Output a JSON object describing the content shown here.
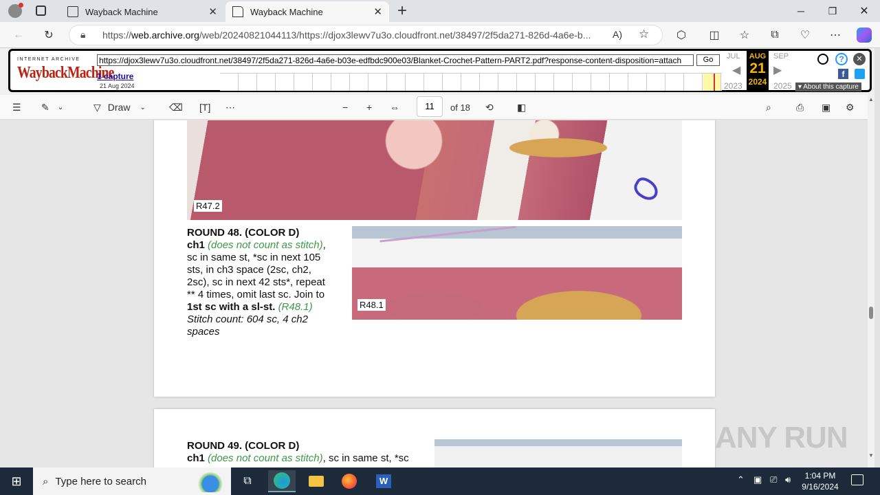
{
  "browser": {
    "tabs": [
      {
        "title": "Wayback Machine",
        "active": false
      },
      {
        "title": "Wayback Machine",
        "active": true
      }
    ],
    "new_tab": "+",
    "url_prefix": "https://",
    "url_domain": "web.archive.org",
    "url_rest": "/web/20240821044113/https://djox3lewv7u3o.cloudfront.net/38497/2f5da271-826d-4a6e-b..."
  },
  "wayback": {
    "logo_top": "INTERNET ARCHIVE",
    "logo": "WaybackMachine",
    "url_value": "https://djox3lewv7u3o.cloudfront.net/38497/2f5da271-826d-4a6e-b03e-edfbdc900e03/Blanket-Crochet-Pattern-PART2.pdf?response-content-disposition=attach",
    "go": "Go",
    "captures": "1 capture",
    "capture_date": "21 Aug 2024",
    "prev_month": "JUL",
    "cur_month": "AUG",
    "next_month": "SEP",
    "day": "21",
    "prev_year": "2023",
    "cur_year": "2024",
    "next_year": "2025",
    "about": "About this capture"
  },
  "pdf": {
    "draw_label": "Draw",
    "page": "11",
    "of_pages": "of 18"
  },
  "content": {
    "photo1_label": "R47.2",
    "photo2_label": "R48.1",
    "r48_title": "ROUND 48. (COLOR D)",
    "r48_l1a": "ch1",
    "r48_l1b": "(does not count as stitch)",
    "r48_l1c": ",",
    "r48_l2": "sc in same st, *sc in next 105",
    "r48_l3": "sts, in ch3 space (2sc, ch2,",
    "r48_l4": "2sc), sc in next 42 sts*, repeat",
    "r48_l5": "** 4 times, omit last sc. Join to",
    "r48_l6a": "1st sc with a sl-st.",
    "r48_l6b": "(R48.1)",
    "r48_l7": "Stitch count: 604 sc, 4 ch2",
    "r48_l8": "spaces",
    "r49_title": "ROUND 49. (COLOR D)",
    "r49_l1a": "ch1",
    "r49_l1b": "(does not count as stitch)",
    "r49_l1c": ", sc in same st, *sc"
  },
  "taskbar": {
    "search_placeholder": "Type here to search",
    "time": "1:04 PM",
    "date": "9/16/2024"
  },
  "watermark": "ANY RUN"
}
